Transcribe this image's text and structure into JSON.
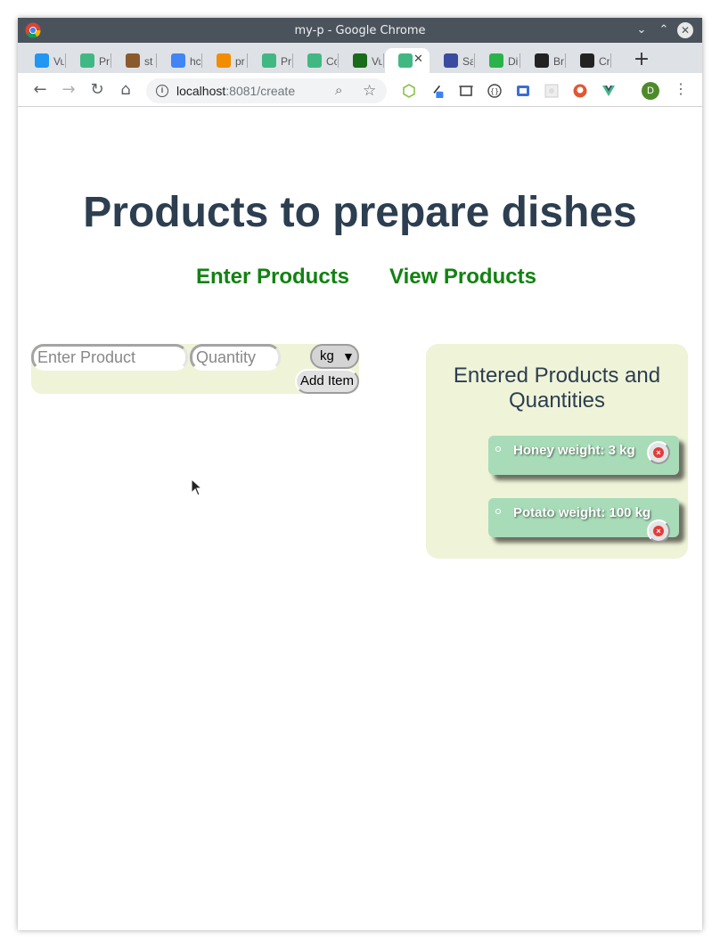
{
  "window": {
    "title": "my-p - Google Chrome",
    "minimize_glyph": "⌄",
    "maximize_glyph": "⌃",
    "close_glyph": "✕"
  },
  "tabs": [
    {
      "label": "Vu",
      "icon": "vue-favicon-icon",
      "color": "#2196f3"
    },
    {
      "label": "Pr",
      "icon": "vue-favicon-icon",
      "color": "#41b883"
    },
    {
      "label": "st",
      "icon": "stack-favicon-icon",
      "color": "#8a5a2b"
    },
    {
      "label": "hc",
      "icon": "google-favicon-icon",
      "color": "#4285f4"
    },
    {
      "label": "pr",
      "icon": "orange-favicon-icon",
      "color": "#f28c00"
    },
    {
      "label": "Pr",
      "icon": "vue-favicon-icon",
      "color": "#41b883"
    },
    {
      "label": "Cc",
      "icon": "vue-favicon-icon",
      "color": "#41b883"
    },
    {
      "label": "Vu",
      "icon": "codeacademy-favicon-icon",
      "color": "#1a6b1a"
    },
    {
      "label": "",
      "icon": "vue-favicon-icon",
      "color": "#41b883",
      "active": true,
      "close": "✕"
    },
    {
      "label": "Sa",
      "icon": "scales-favicon-icon",
      "color": "#3b4ba0"
    },
    {
      "label": "Di",
      "icon": "green-favicon-icon",
      "color": "#2ab34a"
    },
    {
      "label": "Br",
      "icon": "github-favicon-icon",
      "color": "#222222"
    },
    {
      "label": "Cr",
      "icon": "github-favicon-icon",
      "color": "#222222"
    }
  ],
  "new_tab_glyph": "+",
  "toolbar": {
    "back_glyph": "←",
    "forward_glyph": "→",
    "reload_glyph": "↻",
    "home_glyph": "⌂",
    "url_host": "localhost",
    "url_rest": ":8081/create",
    "info_glyph": "i",
    "zoom_glyph": "⌕",
    "star_glyph": "☆",
    "profile_initial": "D",
    "menu_glyph": "⋮"
  },
  "page": {
    "title": "Products to prepare dishes",
    "nav": {
      "enter": "Enter Products",
      "view": "View Products"
    },
    "form": {
      "product_placeholder": "Enter Product",
      "quantity_placeholder": "Quantity",
      "unit_value": "kg",
      "unit_caret": "▼",
      "add_label": "Add Item"
    },
    "list": {
      "heading": "Entered Products and Quantities",
      "items": [
        {
          "text": "Honey weight: 3 kg"
        },
        {
          "text": "Potato weight: 100 kg"
        }
      ],
      "remove_glyph": "×"
    }
  },
  "colors": {
    "title": "#2c3e50",
    "nav_link": "#128212",
    "panel_bg": "#eff3d8",
    "card_bg": "#a8dcb8",
    "remove_red": "#e33b3b"
  }
}
